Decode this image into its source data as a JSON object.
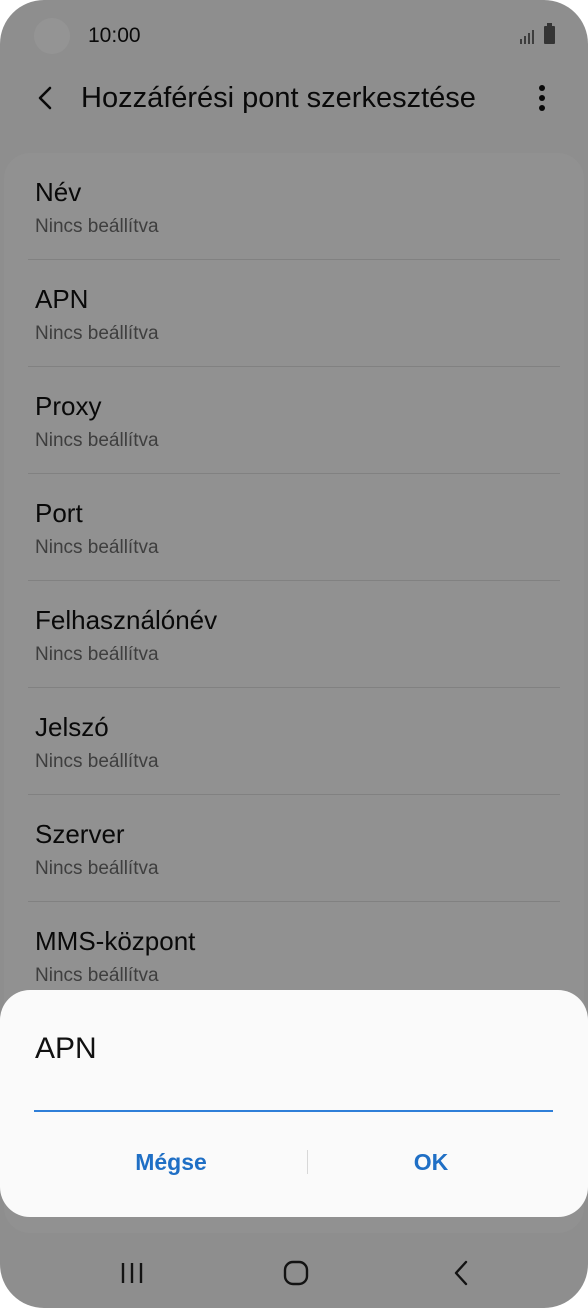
{
  "status_bar": {
    "time": "10:00"
  },
  "app_bar": {
    "title": "Hozzáférési pont szerkesztése"
  },
  "settings": [
    {
      "label": "Név",
      "value": "Nincs beállítva"
    },
    {
      "label": "APN",
      "value": "Nincs beállítva"
    },
    {
      "label": "Proxy",
      "value": "Nincs beállítva"
    },
    {
      "label": "Port",
      "value": "Nincs beállítva"
    },
    {
      "label": "Felhasználónév",
      "value": "Nincs beállítva"
    },
    {
      "label": "Jelszó",
      "value": "Nincs beállítva"
    },
    {
      "label": "Szerver",
      "value": "Nincs beállítva"
    },
    {
      "label": "MMS-központ",
      "value": "Nincs beállítva"
    }
  ],
  "dialog": {
    "title": "APN",
    "input_value": "",
    "cancel_label": "Mégse",
    "ok_label": "OK"
  },
  "colors": {
    "accent": "#1f6fc5",
    "input_underline": "#2f7fd8"
  }
}
